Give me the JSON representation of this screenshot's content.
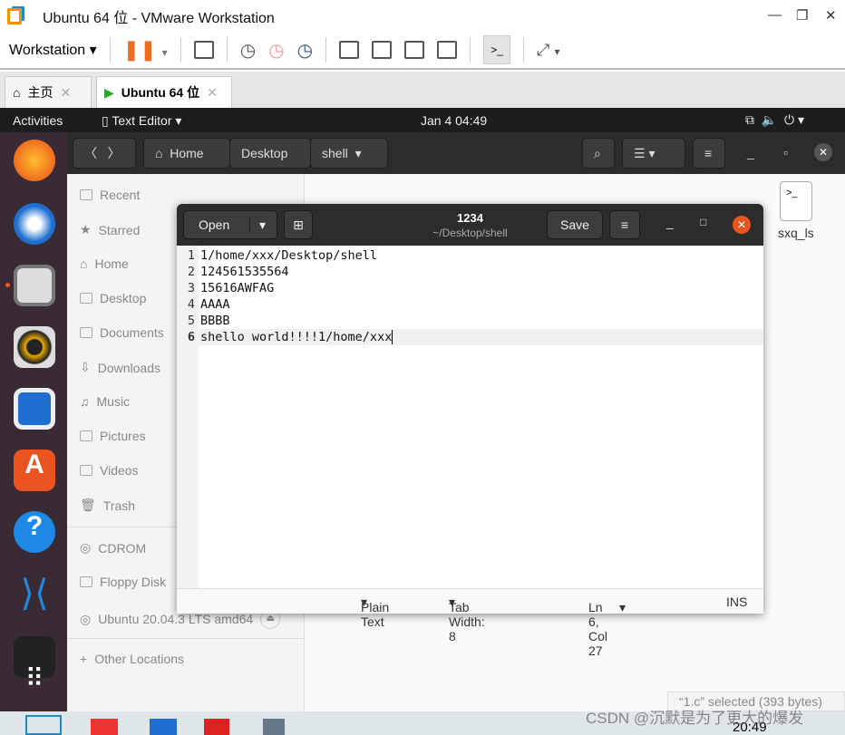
{
  "vmware": {
    "title": "Ubuntu 64 位 - VMware Workstation",
    "menu": "Workstation",
    "tabs": [
      {
        "label": "主页"
      },
      {
        "label": "Ubuntu 64 位"
      }
    ]
  },
  "topbar": {
    "activities": "Activities",
    "app": "Text Editor",
    "clock": "Jan 4  04:49"
  },
  "files": {
    "path": [
      "Home",
      "Desktop",
      "shell"
    ],
    "sidebar": [
      "Recent",
      "Starred",
      "Home",
      "Desktop",
      "Documents",
      "Downloads",
      "Music",
      "Pictures",
      "Videos",
      "Trash",
      "CDROM",
      "Floppy Disk",
      "Ubuntu 20.04.3 LTS amd64",
      "Other Locations"
    ],
    "file_label": "sxq_ls",
    "status": "“1.c” selected  (393 bytes)"
  },
  "editor": {
    "open": "Open",
    "save": "Save",
    "title": "1234",
    "subtitle": "~/Desktop/shell",
    "lines": [
      "1/home/xxx/Desktop/shell",
      "124561535564",
      "15616AWFAG",
      "AAAA",
      "BBBB",
      "shello world!!!!1/home/xxx"
    ],
    "line_numbers": [
      "1",
      "2",
      "3",
      "4",
      "5",
      "6"
    ],
    "status": {
      "lang": "Plain Text",
      "tab": "Tab Width: 8",
      "pos": "Ln 6, Col 27",
      "mode": "INS"
    }
  },
  "taskbar": {
    "time": "20:49"
  },
  "watermark": "CSDN @沉默是为了更大的爆发",
  "colors": {
    "accent": "#e95420",
    "dock": "#3a2a33"
  }
}
